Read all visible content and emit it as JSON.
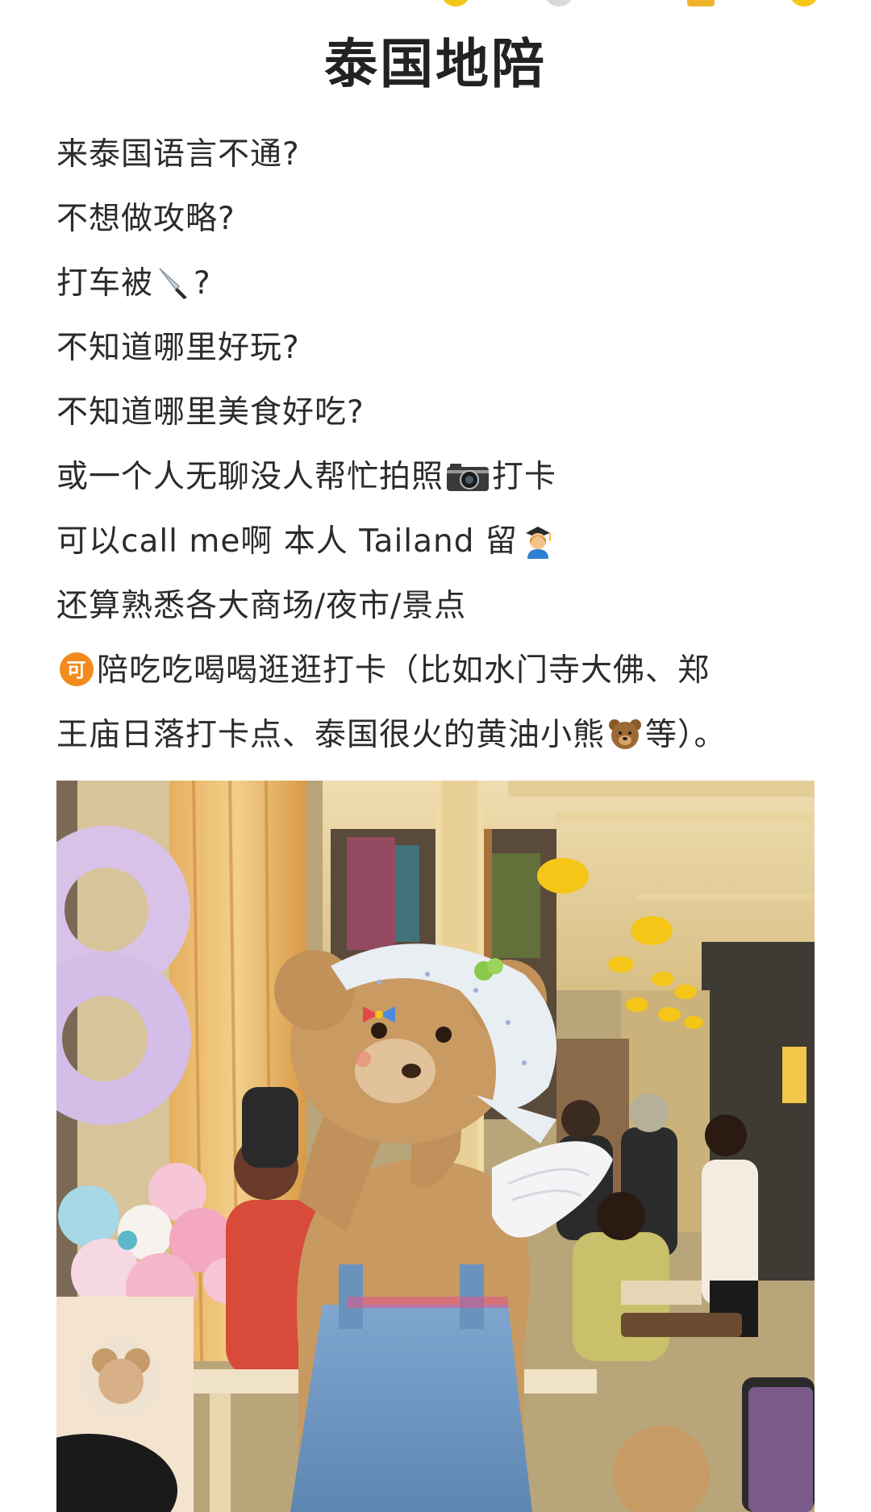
{
  "post": {
    "title": "泰国地陪",
    "lines": [
      {
        "a": "来泰国语言不通?"
      },
      {
        "a": "不想做攻略?"
      },
      {
        "a": "打车被",
        "b": "?"
      },
      {
        "a": "不知道哪里好玩?"
      },
      {
        "a": "不知道哪里美食好吃?"
      },
      {
        "a": "或一个人无聊没人帮忙拍照",
        "b": "打卡"
      },
      {
        "a": "可以call me啊  本人 Tailand 留"
      },
      {
        "a": "还算熟悉各大商场/夜市/景点"
      },
      {
        "a": "陪吃吃喝喝逛逛打卡（比如水门寺大佛、郑"
      },
      {
        "a": "王庙日落打卡点、泰国很火的黄油小熊",
        "b": "等）。"
      }
    ]
  },
  "icons": {
    "knife": "knife-icon",
    "camera": "camera-icon",
    "graduate": "student-icon",
    "ke_badge": "可",
    "bear": "bear-face-icon"
  },
  "colors": {
    "text": "#2b2b2b",
    "title": "#222222",
    "badge": "#f28a1e"
  }
}
